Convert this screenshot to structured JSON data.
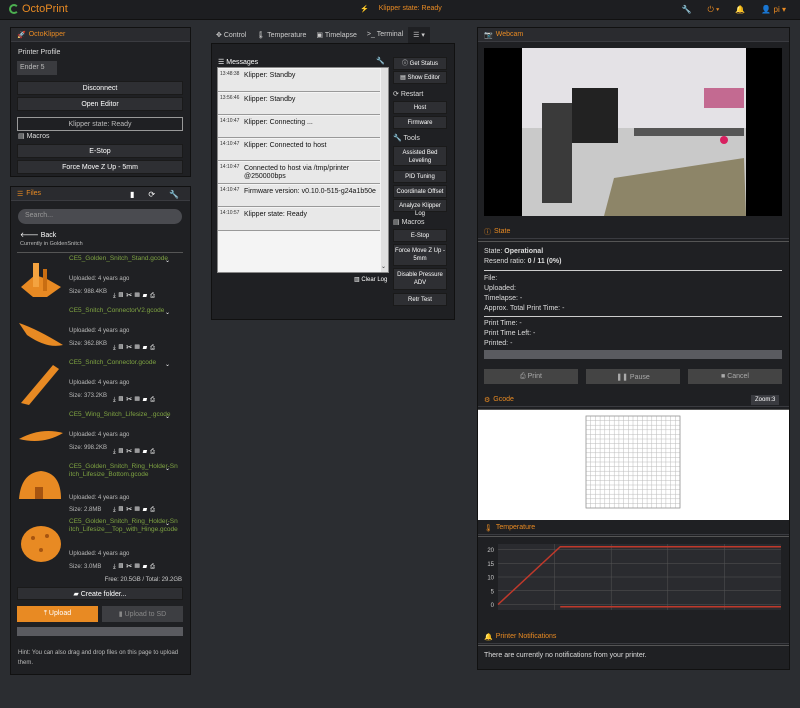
{
  "navbar": {
    "brand": "OctoPrint",
    "klipper_state": "Klipper state: Ready",
    "user": "pi"
  },
  "octoklipper": {
    "title": "OctoKlipper",
    "printer_profile_label": "Printer Profile",
    "printer_profile_value": "Ender 5",
    "disconnect": "Disconnect",
    "open_editor": "Open Editor",
    "state_display": "Klipper state: Ready",
    "macros_label": "Macros",
    "estop": "E-Stop",
    "force_move": "Force Move Z Up - 5mm"
  },
  "files": {
    "title": "Files",
    "search_placeholder": "Search...",
    "back": "Back",
    "current_folder": "Currently in GoldenSnitch",
    "items": [
      {
        "name": "CE5_Golden_Snitch_Stand.gcode",
        "uploaded": "Uploaded: 4 years ago",
        "size": "Size: 988.4KB"
      },
      {
        "name": "CE5_Snitch_ConnectorV2.gcode",
        "uploaded": "Uploaded: 4 years ago",
        "size": "Size: 362.8KB"
      },
      {
        "name": "CE5_Snitch_Connector.gcode",
        "uploaded": "Uploaded: 4 years ago",
        "size": "Size: 373.2KB"
      },
      {
        "name": "CE5_Wing_Snitch_Lifesize_.gcode",
        "uploaded": "Uploaded: 4 years ago",
        "size": "Size: 998.2KB"
      },
      {
        "name": "CE5_Golden_Snitch_Ring_Holder-Snitch_Lifesize_Bottom.gcode",
        "uploaded": "Uploaded: 4 years ago",
        "size": "Size: 2.8MB"
      },
      {
        "name": "CE5_Golden_Snitch_Ring_Holder-Snitch_Lifesize__Top_with_Hinge.gcode",
        "uploaded": "Uploaded: 4 years ago",
        "size": "Size: 3.0MB"
      }
    ],
    "free_total": "Free: 20.5GB / Total: 29.2GB",
    "create_folder": "Create folder...",
    "upload": "Upload",
    "upload_sd": "Upload to SD",
    "hint": "Hint: You can also drag and drop files on this page to upload them."
  },
  "tabs": [
    "Control",
    "Temperature",
    "Timelapse",
    "Terminal"
  ],
  "messages": {
    "title": "Messages",
    "rows": [
      {
        "ts": "13:48:38",
        "text": "Klipper: Standby"
      },
      {
        "ts": "13:56:46",
        "text": "Klipper: Standby"
      },
      {
        "ts": "14:10:47",
        "text": "Klipper: Connecting ..."
      },
      {
        "ts": "14:10:47",
        "text": "Klipper: Connected to host"
      },
      {
        "ts": "14:10:47",
        "text": "Connected to host via /tmp/printer @250000bps"
      },
      {
        "ts": "14:10:47",
        "text": "Firmware version: v0.10.0-515-g24a1b50e"
      },
      {
        "ts": "14:10:57",
        "text": "Klipper state: Ready"
      }
    ],
    "clear_log": "Clear Log"
  },
  "side": {
    "get_status": "Get Status",
    "show_editor": "Show Editor",
    "restart_label": "Restart",
    "host": "Host",
    "firmware": "Firmware",
    "tools_label": "Tools",
    "assisted_bed_leveling": "Assisted Bed Leveling",
    "pid_tuning": "PID Tuning",
    "coordinate_offset": "Coordinate Offset",
    "analyze_log": "Analyze Klipper Log",
    "macros_label": "Macros",
    "estop": "E-Stop",
    "force_move": "Force Move Z Up - 5mm",
    "disable_pa": "Disable Pressure ADV",
    "retr_test": "Retr Test"
  },
  "webcam": {
    "title": "Webcam"
  },
  "state": {
    "title": "State",
    "state_label": "State:",
    "state_value": "Operational",
    "resend_label": "Resend ratio:",
    "resend_value": "0 / 11 (0%)",
    "file": "File:",
    "uploaded": "Uploaded:",
    "timelapse": "Timelapse: -",
    "approx_total": "Approx. Total Print Time: -",
    "print_time": "Print Time: -",
    "print_time_left": "Print Time Left: -",
    "printed": "Printed: -",
    "progress": 0,
    "print_btn": "Print",
    "pause_btn": "Pause",
    "cancel_btn": "Cancel"
  },
  "gcode": {
    "title": "Gcode",
    "zoom": "Zoom:3"
  },
  "temperature": {
    "title": "Temperature"
  },
  "notifications": {
    "title": "Printer Notifications",
    "text": "There are currently no notifications from your printer."
  },
  "chart_data": {
    "type": "line",
    "yticks": [
      0,
      5,
      10,
      15,
      20
    ],
    "ylim": [
      -2,
      22
    ],
    "series": [
      {
        "color": "#c0392b",
        "x": [
          0,
          0.22,
          1
        ],
        "y": [
          0,
          21,
          21
        ]
      },
      {
        "color": "#c0392b",
        "x": [
          0.22,
          1
        ],
        "y": [
          -0.8,
          -0.8
        ]
      }
    ]
  }
}
